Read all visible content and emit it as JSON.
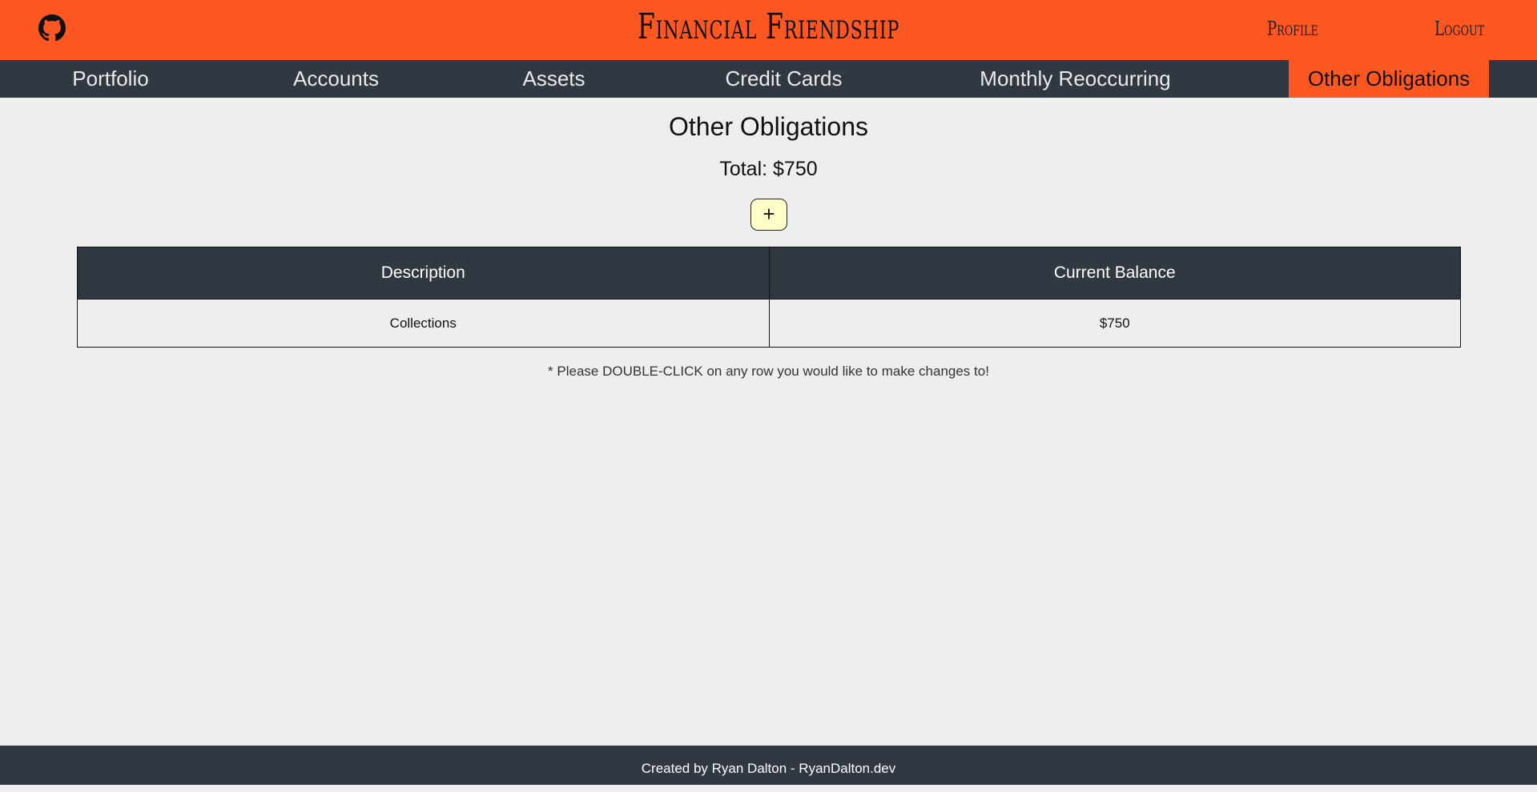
{
  "header": {
    "brand": "Financial Friendship",
    "profile_label": "Profile",
    "logout_label": "Logout",
    "github_icon": "github-icon"
  },
  "nav": {
    "items": [
      {
        "label": "Portfolio",
        "active": false
      },
      {
        "label": "Accounts",
        "active": false
      },
      {
        "label": "Assets",
        "active": false
      },
      {
        "label": "Credit Cards",
        "active": false
      },
      {
        "label": "Monthly Reoccurring",
        "active": false
      },
      {
        "label": "Other Obligations",
        "active": true
      }
    ]
  },
  "main": {
    "title": "Other Obligations",
    "total": "Total: $750",
    "add_label": "+",
    "table": {
      "headers": [
        "Description",
        "Current Balance"
      ],
      "rows": [
        [
          "Collections",
          "$750"
        ]
      ]
    },
    "note": "* Please DOUBLE-CLICK on any row you would like to make changes to!"
  },
  "footer": {
    "text": "Created by Ryan Dalton - RyanDalton.dev"
  },
  "colors": {
    "brand_orange": "#ff5722",
    "dark_slate": "#303841",
    "background": "#eeeeee",
    "add_button": "#ffffc8"
  }
}
